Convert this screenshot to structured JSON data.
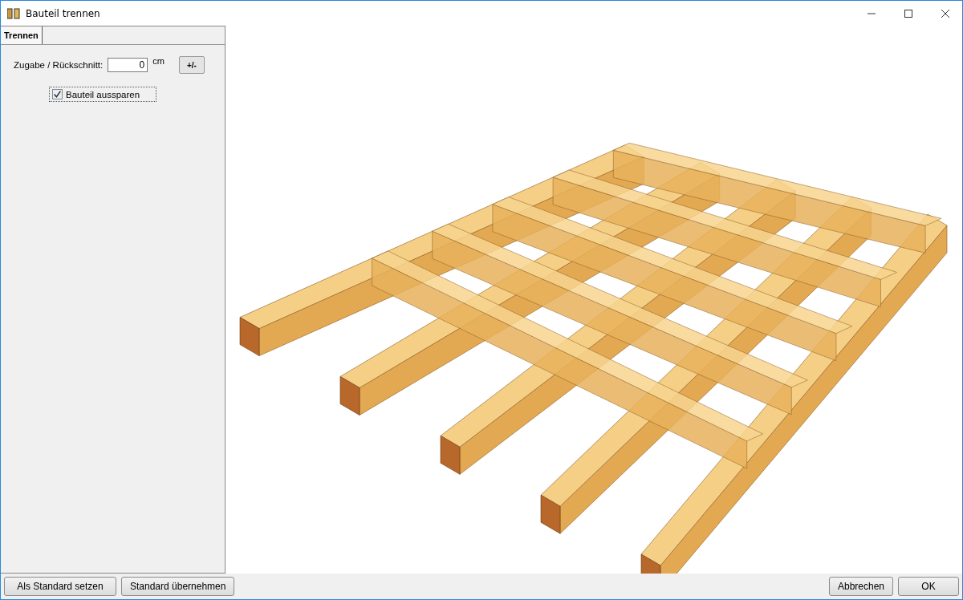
{
  "window": {
    "title": "Bauteil trennen"
  },
  "tabs": [
    {
      "label": "Trennen",
      "selected": true
    }
  ],
  "settings": {
    "offset": {
      "label": "Zugabe / Rückschnitt:",
      "value": "0",
      "unit": "cm",
      "toggle_button": "+/-"
    },
    "recess": {
      "label": "Bauteil aussparen",
      "checked": true
    }
  },
  "footer": {
    "left_buttons": [
      "Als Standard setzen",
      "Standard übernehmen"
    ],
    "right_buttons": [
      "Abbrechen",
      "OK"
    ]
  }
}
